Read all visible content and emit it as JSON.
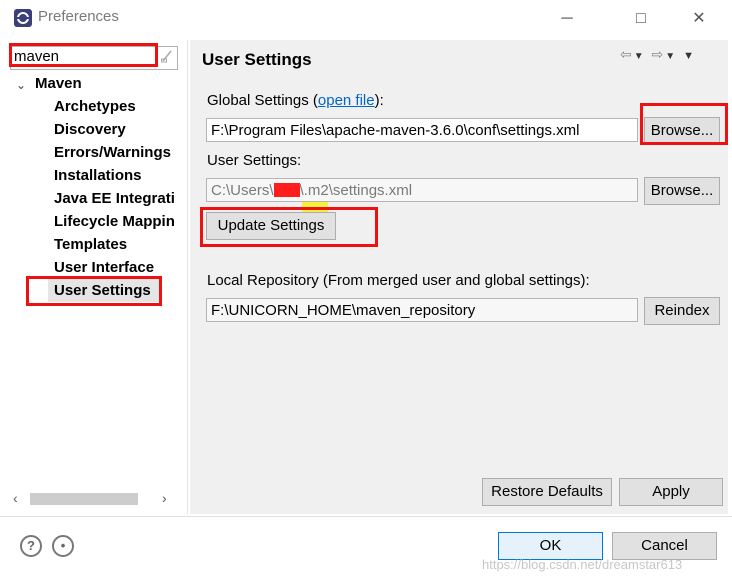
{
  "window": {
    "title": "Preferences",
    "minimize_icon": "─",
    "maximize_icon": "□",
    "close_icon": "✕"
  },
  "sidebar": {
    "filter_value": "maven",
    "root": "Maven",
    "items": [
      {
        "label": "Archetypes"
      },
      {
        "label": "Discovery"
      },
      {
        "label": "Errors/Warnings"
      },
      {
        "label": "Installations"
      },
      {
        "label": "Java EE Integrati"
      },
      {
        "label": "Lifecycle Mappin"
      },
      {
        "label": "Templates"
      },
      {
        "label": "User Interface"
      },
      {
        "label": "User Settings",
        "selected": true
      }
    ]
  },
  "page": {
    "title": "User Settings",
    "global_label_prefix": "Global Settings (",
    "global_label_link": "open file",
    "global_label_suffix": "):",
    "global_path": "F:\\Program Files\\apache-maven-3.6.0\\conf\\settings.xml",
    "browse_label": "Browse...",
    "user_label": "User Settings:",
    "user_path_prefix": "C:\\Users\\",
    "user_path_suffix": "\\.m2\\settings.xml",
    "update_label": "Update Settings",
    "local_repo_label": "Local Repository (From merged user and global settings):",
    "local_repo_path": "F:\\UNICORN_HOME\\maven_repository",
    "reindex_label": "Reindex",
    "restore_label": "Restore Defaults",
    "apply_label": "Apply"
  },
  "footer": {
    "ok_label": "OK",
    "cancel_label": "Cancel",
    "watermark": "https://blog.csdn.net/dreamstar613"
  },
  "colors": {
    "annotation_red": "#ee1111",
    "link": "#0066cc",
    "highlight": "#f4f400"
  }
}
